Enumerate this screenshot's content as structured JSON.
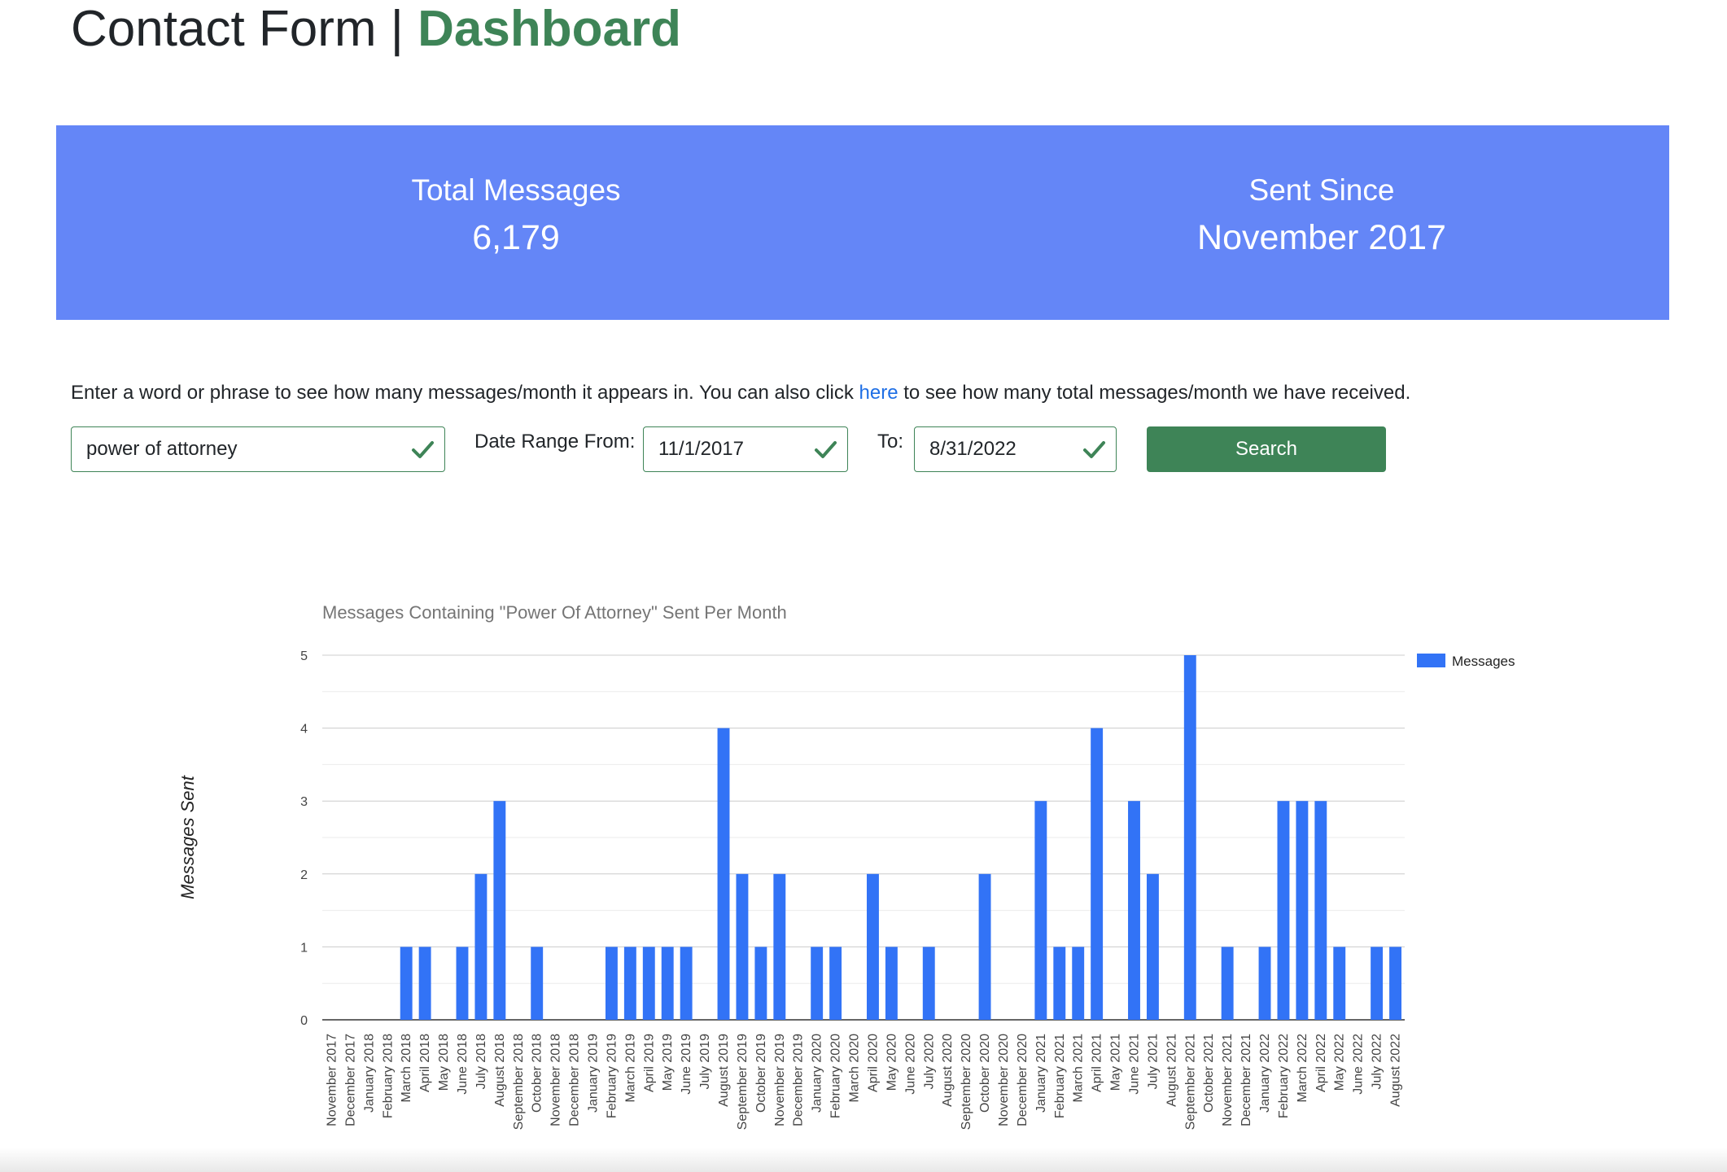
{
  "header": {
    "title_main": "Contact Form |",
    "title_accent": "Dashboard"
  },
  "stats": {
    "total_label": "Total Messages",
    "total_value": "6,179",
    "since_label": "Sent Since",
    "since_value": "November 2017"
  },
  "intro": {
    "text_before": "Enter a word or phrase to see how many messages/month it appears in. You can also click",
    "link_text": "here",
    "text_after": "to see how many total messages/month we have received."
  },
  "search": {
    "keyword_value": "power of attorney",
    "from_label": "Date Range From:",
    "from_value": "11/1/2017",
    "to_label": "To:",
    "to_value": "8/31/2022",
    "button_label": "Search"
  },
  "colors": {
    "accent_green": "#3e8457",
    "banner_blue": "#6486f7",
    "bar_blue": "#3273f6",
    "link_blue": "#1f6fe5"
  },
  "chart_data": {
    "type": "bar",
    "title": "Messages Containing \"Power Of Attorney\" Sent Per Month",
    "xlabel": "",
    "ylabel": "Messages Sent",
    "ylim": [
      0,
      5
    ],
    "yticks": [
      0,
      1,
      2,
      3,
      4,
      5
    ],
    "legend": "right",
    "grid": true,
    "categories": [
      "November 2017",
      "December 2017",
      "January 2018",
      "February 2018",
      "March 2018",
      "April 2018",
      "May 2018",
      "June 2018",
      "July 2018",
      "August 2018",
      "September 2018",
      "October 2018",
      "November 2018",
      "December 2018",
      "January 2019",
      "February 2019",
      "March 2019",
      "April 2019",
      "May 2019",
      "June 2019",
      "July 2019",
      "August 2019",
      "September 2019",
      "October 2019",
      "November 2019",
      "December 2019",
      "January 2020",
      "February 2020",
      "March 2020",
      "April 2020",
      "May 2020",
      "June 2020",
      "July 2020",
      "August 2020",
      "September 2020",
      "October 2020",
      "November 2020",
      "December 2020",
      "January 2021",
      "February 2021",
      "March 2021",
      "April 2021",
      "May 2021",
      "June 2021",
      "July 2021",
      "August 2021",
      "September 2021",
      "October 2021",
      "November 2021",
      "December 2021",
      "January 2022",
      "February 2022",
      "March 2022",
      "April 2022",
      "May 2022",
      "June 2022",
      "July 2022",
      "August 2022"
    ],
    "series": [
      {
        "name": "Messages",
        "values": [
          0,
          0,
          0,
          0,
          1,
          1,
          0,
          1,
          2,
          3,
          0,
          1,
          0,
          0,
          0,
          1,
          1,
          1,
          1,
          1,
          0,
          4,
          2,
          1,
          2,
          0,
          1,
          1,
          0,
          2,
          1,
          0,
          1,
          0,
          0,
          2,
          0,
          0,
          3,
          1,
          1,
          4,
          0,
          3,
          2,
          0,
          5,
          0,
          1,
          0,
          1,
          3,
          3,
          3,
          1,
          0,
          1,
          1
        ]
      }
    ]
  }
}
